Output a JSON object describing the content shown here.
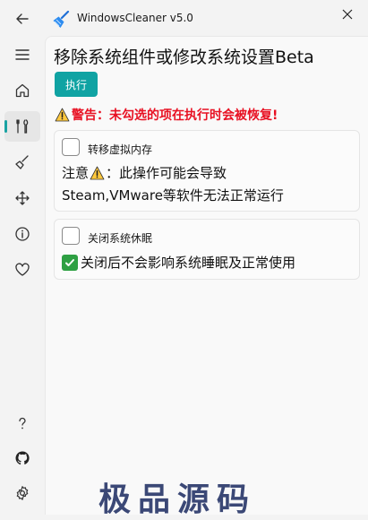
{
  "window": {
    "title": "WindowsCleaner v5.0"
  },
  "sidebar": {
    "top_items": [
      {
        "icon": "back-arrow-icon"
      },
      {
        "icon": "hamburger-menu-icon"
      },
      {
        "icon": "home-icon"
      },
      {
        "icon": "tools-icon"
      },
      {
        "icon": "broom-icon"
      },
      {
        "icon": "move-arrows-icon"
      },
      {
        "icon": "info-icon"
      },
      {
        "icon": "heart-icon"
      }
    ],
    "bottom_items": [
      {
        "icon": "help-question-icon"
      },
      {
        "icon": "github-icon"
      },
      {
        "icon": "settings-gear-icon"
      }
    ],
    "active_item": "tools-icon"
  },
  "page": {
    "title": "移除系统组件或修改系统设置Beta",
    "run_button": "执行",
    "warning": "警告：未勾选的项在执行时会被恢复!",
    "options": [
      {
        "label": "转移虚拟内存",
        "checked": false,
        "note_prefix": "注意",
        "note_suffix": "：此操作可能会导致",
        "note_line2": "Steam,VMware等软件无法正常运行"
      },
      {
        "label": "关闭系统休眠",
        "checked": false,
        "note": "关闭后不会影响系统睡眠及正常使用"
      }
    ]
  },
  "watermark": "极品源码",
  "colors": {
    "accent": "#10a3a3",
    "warning": "#e81123",
    "check": "#2ea043"
  }
}
